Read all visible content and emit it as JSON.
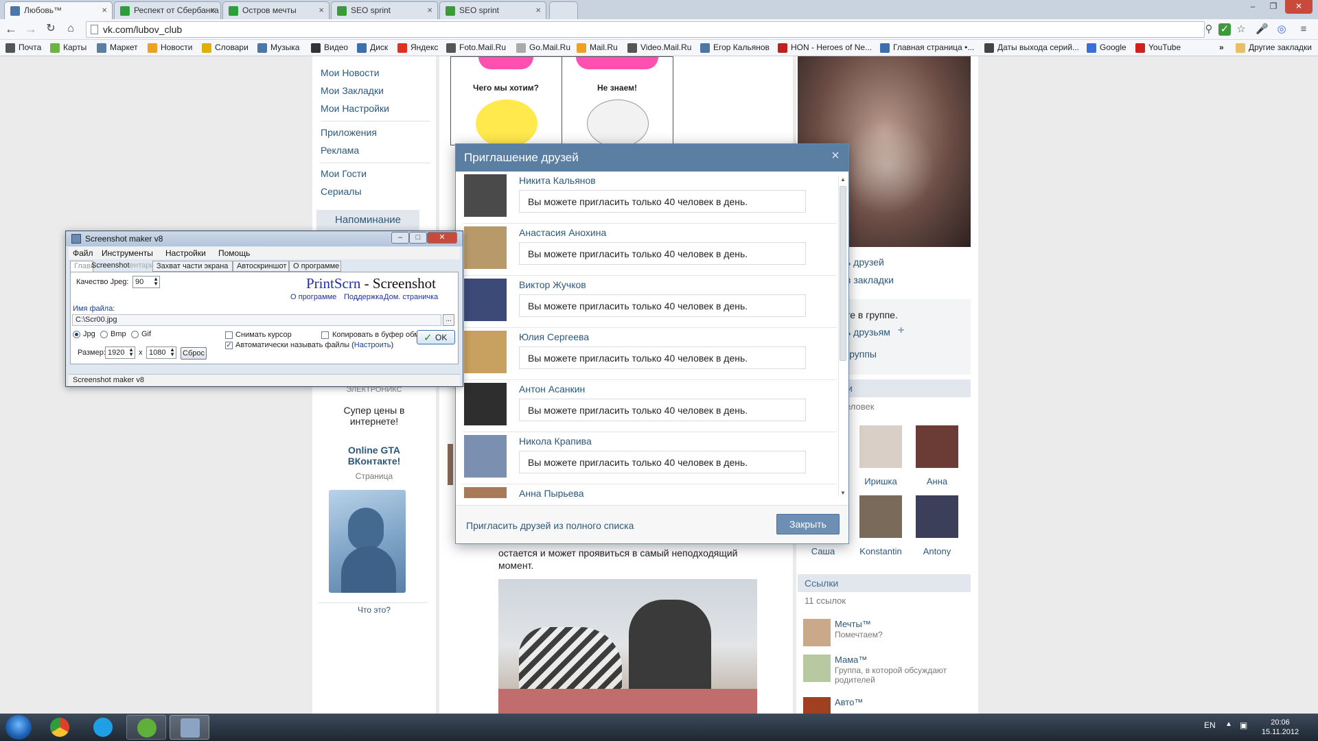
{
  "browser": {
    "tabs": [
      {
        "label": "Любовь™",
        "active": true,
        "icon_color": "#4a76a8"
      },
      {
        "label": "Респект от Сбербанка",
        "active": false,
        "icon_color": "#2e9e3a"
      },
      {
        "label": "Остров мечты",
        "active": false,
        "icon_color": "#2e9e3a"
      },
      {
        "label": "SEO sprint",
        "active": false,
        "icon_color": "#3d9a3a"
      },
      {
        "label": "SEO sprint",
        "active": false,
        "icon_color": "#3d9a3a"
      }
    ],
    "url": "vk.com/lubov_club",
    "bookmarks": [
      {
        "label": "Почта",
        "icon_color": "#555"
      },
      {
        "label": "Карты",
        "icon_color": "#6cb33f"
      },
      {
        "label": "Маркет",
        "icon_color": "#5b7ea3"
      },
      {
        "label": "Новости",
        "icon_color": "#f0a020"
      },
      {
        "label": "Словари",
        "icon_color": "#e0b000"
      },
      {
        "label": "Музыка",
        "icon_color": "#4a76a8"
      },
      {
        "label": "Видео",
        "icon_color": "#333"
      },
      {
        "label": "Диск",
        "icon_color": "#3a6fb0"
      },
      {
        "label": "Яндекс",
        "icon_color": "#e03020"
      },
      {
        "label": "Foto.Mail.Ru",
        "icon_color": "#555"
      },
      {
        "label": "Go.Mail.Ru",
        "icon_color": "#aaa"
      },
      {
        "label": "Mail.Ru",
        "icon_color": "#f0a020"
      },
      {
        "label": "Video.Mail.Ru",
        "icon_color": "#555"
      },
      {
        "label": "Егор Кальянов",
        "icon_color": "#4a76a8"
      },
      {
        "label": "HON - Heroes of Ne...",
        "icon_color": "#c02020"
      },
      {
        "label": "Главная страница •...",
        "icon_color": "#3a6fb0"
      },
      {
        "label": "Даты выхода серий...",
        "icon_color": "#444"
      },
      {
        "label": "Google",
        "icon_color": "#3a6fd8"
      },
      {
        "label": "YouTube",
        "icon_color": "#d02020"
      }
    ],
    "bookmarks_overflow": "»",
    "other_bookmarks": "Другие закладки"
  },
  "vk_left": {
    "menu": [
      {
        "label": "Мои Новости"
      },
      {
        "label": "Мои Закладки"
      },
      {
        "label": "Мои Настройки"
      },
      {
        "label": "Приложения"
      },
      {
        "label": "Реклама"
      },
      {
        "label": "Мои Гости"
      },
      {
        "label": "Сериалы"
      }
    ],
    "reminder": "Напоминание",
    "ad_partial": "ЭЛЕКТРОНИКС",
    "ad1_text": "Супер цены в интернете!",
    "ad2_title": "Online GTA ВКонтакте!",
    "ad2_sub": "Страница",
    "what_is_this": "Что это?"
  },
  "vk_center": {
    "comic_caption_1": "Чего мы хотим?",
    "comic_caption_2": "Не знаем!",
    "post_text": "остается и может проявиться в самый неподходящий момент."
  },
  "vk_right": {
    "link_invite_friends": "ь друзей",
    "link_bookmarks": "в закладки",
    "in_group": "те в группе.",
    "tell_friends": "ь друзьям",
    "plus_icon": "+",
    "groups_link": "группы",
    "members_head": "и",
    "members_count": "еловек",
    "members": [
      {
        "name": "Иришка",
        "color": "#d9cfc7"
      },
      {
        "name": "Анна",
        "color": "#6b3b35"
      },
      {
        "name": "Саша",
        "color": "#cfcfcf"
      },
      {
        "name": "Konstantin",
        "color": "#7a6a5a"
      },
      {
        "name": "Antony",
        "color": "#3b3f5a"
      }
    ],
    "links_head": "Ссылки",
    "links_count": "11 ссылок",
    "links": [
      {
        "name": "Мечты™",
        "desc": "Помечтаем?",
        "color": "#c9a98a"
      },
      {
        "name": "Мама™",
        "desc": "Группа, в которой обсуждают родителей",
        "color": "#b8c8a0"
      },
      {
        "name": "Авто™",
        "desc": "",
        "color": "#a04020"
      }
    ]
  },
  "invite_modal": {
    "title": "Приглашение друзей",
    "close_icon": "×",
    "friends": [
      {
        "name": "Никита Кальянов",
        "message": "Вы можете пригласить только 40 человек в день.",
        "avatar_color": "#4a4a4a"
      },
      {
        "name": "Анастасия Анохина",
        "message": "Вы можете пригласить только 40 человек в день.",
        "avatar_color": "#b89a6a"
      },
      {
        "name": "Виктор Жучков",
        "message": "Вы можете пригласить только 40 человек в день.",
        "avatar_color": "#3c4a78"
      },
      {
        "name": "Юлия Сергеева",
        "message": "Вы можете пригласить только 40 человек в день.",
        "avatar_color": "#c8a060"
      },
      {
        "name": "Антон Асанкин",
        "message": "Вы можете пригласить только 40 человек в день.",
        "avatar_color": "#2e2e2e"
      },
      {
        "name": "Никола Крапива",
        "message": "Вы можете пригласить только 40 человек в день.",
        "avatar_color": "#7b8fb0"
      },
      {
        "name": "Анна Пырьева",
        "message": "",
        "avatar_color": "#a87a5a"
      }
    ],
    "invite_all": "Пригласить друзей из полного списка",
    "close_button": "Закрыть"
  },
  "screenshot_maker": {
    "title": "Screenshot maker v8",
    "menu": [
      "Файл",
      "Инструменты",
      "Настройки",
      "Помощь"
    ],
    "tabs": [
      "Главн",
      "Screenshot",
      "ентарии",
      "Захват части экрана",
      "Автоскриншот",
      "О программе"
    ],
    "jpeg_quality_label": "Качество Jpeg:",
    "jpeg_quality": "90",
    "brand_1": "PrintScrn",
    "brand_sep": " - ",
    "brand_2": "Screenshot",
    "links": [
      "О программе",
      "Поддержка",
      "Дом. страничка"
    ],
    "filename_label": "Имя файла:",
    "filename": "C:\\Scr00.jpg",
    "browse": "...",
    "formats": [
      "Jpg",
      "Bmp",
      "Gif"
    ],
    "capture_cursor": "Снимать курсор",
    "copy_clipboard": "Копировать в буфер обмена",
    "auto_name": "Автоматически называть файлы (",
    "configure": "Настроить",
    "auto_name_close": ")",
    "size_label": "Размер:",
    "width": "1920",
    "times": "x",
    "height": "1080",
    "reset": "Сброс",
    "ok": "OK",
    "status": "Screenshot maker v8"
  },
  "taskbar": {
    "lang": "EN",
    "time": "20:06",
    "date": "15.11.2012"
  }
}
